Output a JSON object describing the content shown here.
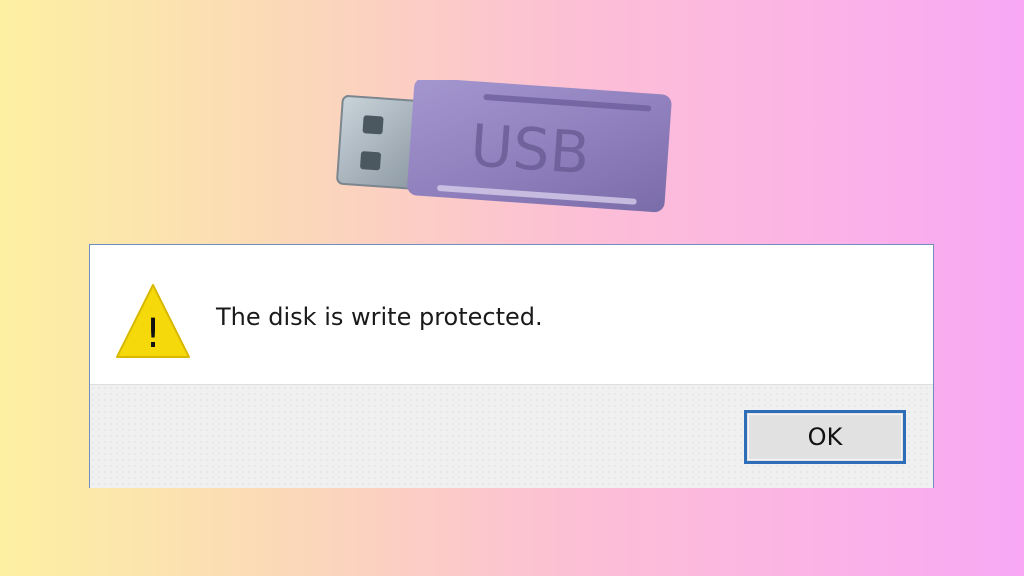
{
  "usb_label": "USB",
  "dialog": {
    "message": "The disk is write protected.",
    "ok_label": "OK",
    "icon": "warning-icon",
    "icon_symbol": "!"
  },
  "colors": {
    "background_left": "#fdf0a2",
    "background_right": "#f8a8f4",
    "usb_body": "#8a7db8",
    "warning_yellow": "#f5d90a",
    "button_border": "#2f6db8",
    "footer": "#f0f0f0"
  }
}
